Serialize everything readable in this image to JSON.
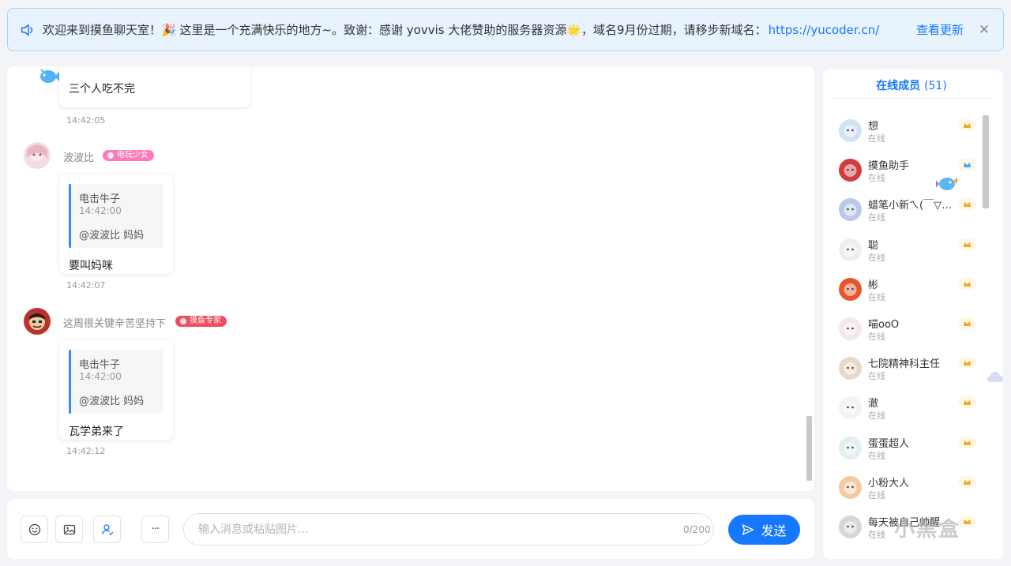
{
  "notice": {
    "text": "欢迎来到摸鱼聊天室！🎉 这里是一个充满快乐的地方~。致谢：感谢 yovvis 大佬赞助的服务器资源🌟，域名9月份过期，请移步新域名：",
    "link": "https://yucoder.cn/",
    "update_label": "查看更新",
    "close": "✕"
  },
  "chat": {
    "messages": [
      {
        "text": "三个人吃不完",
        "time": "14:42:05"
      },
      {
        "user": "波波比",
        "badge": "电玩少女",
        "quote_user": "电击牛子",
        "quote_time": "14:42:00",
        "quote_text": "@波波比 妈妈",
        "reply": "要叫妈咪",
        "time": "14:42:07"
      },
      {
        "user": "这周很关键辛苦坚持下",
        "badge": "摸鱼专家",
        "quote_user": "电击牛子",
        "quote_time": "14:42:00",
        "quote_text": "@波波比 妈妈",
        "reply": "瓦学弟来了",
        "time": "14:42:12"
      }
    ]
  },
  "input": {
    "placeholder": "输入消息或粘贴图片...",
    "counter": "0/200",
    "send_label": "发送",
    "more_label": "···"
  },
  "members": {
    "title": "在线成员",
    "count": "(51)",
    "list": [
      {
        "name": "想",
        "status": "在线"
      },
      {
        "name": "摸鱼助手",
        "status": "在线"
      },
      {
        "name": "蜡笔小新ㄟ(￣▽￣ㄟ)",
        "status": "在线"
      },
      {
        "name": "聪",
        "status": "在线"
      },
      {
        "name": "彬",
        "status": "在线"
      },
      {
        "name": "喵ooO",
        "status": "在线"
      },
      {
        "name": "七院精神科主任",
        "status": "在线"
      },
      {
        "name": "澈",
        "status": "在线"
      },
      {
        "name": "蛋蛋超人",
        "status": "在线"
      },
      {
        "name": "小粉大人",
        "status": "在线"
      },
      {
        "name": "每天被自己帅醒",
        "status": "在线"
      }
    ]
  },
  "watermark": "小黑盒",
  "colors": {
    "accent": "#1677ff",
    "badge_pink": "#ff6fb1",
    "badge_red": "#f04d60",
    "level_gold": "#f5a623"
  },
  "icons": [
    "speaker-icon",
    "close-icon",
    "fish-icon",
    "emoji-icon",
    "image-icon",
    "mention-icon",
    "more-icon",
    "send-icon",
    "level-icon"
  ]
}
